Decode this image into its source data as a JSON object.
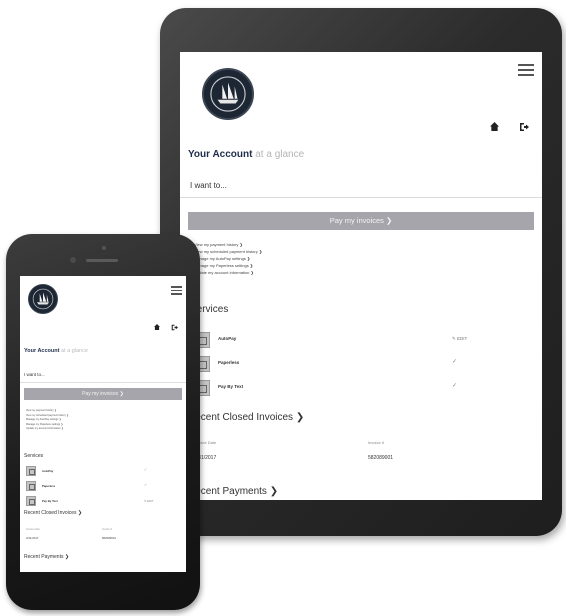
{
  "account": {
    "title": "Your Account",
    "subtitle": "at a glance",
    "i_want_to": "I want to...",
    "pay_button": "Pay my invoices  ❯",
    "links": [
      "View my payment history ❯",
      "View my scheduled payment history ❯",
      "Manage my AutoPay settings ❯",
      "Manage my Paperless settings ❯",
      "Update my account information ❯"
    ]
  },
  "services": {
    "heading": "Services",
    "items": [
      {
        "name": "AutoPay",
        "status": "✎ EDIT"
      },
      {
        "name": "Paperless",
        "status": "✓"
      },
      {
        "name": "Pay By Text",
        "status": "✓"
      }
    ]
  },
  "recent_closed_invoices": {
    "heading": "Recent Closed Invoices  ❯",
    "col_date": "Invoice Date",
    "col_number": "Invoice #",
    "row": {
      "date": "3/31/2017",
      "number": "582089001"
    }
  },
  "recent_payments": {
    "heading": "Recent Payments  ❯"
  },
  "phone": {
    "i_want_to": "I want to...",
    "services_items": [
      {
        "name": "AutoPay",
        "status": "✓"
      },
      {
        "name": "Paperless",
        "status": "✓"
      },
      {
        "name": "Pay By Text",
        "status": "✎ EDIT"
      }
    ],
    "row": {
      "date": "3/31/2017",
      "number": "582089001"
    }
  },
  "colors": {
    "brand_navy": "#1f2d4a",
    "button_gray": "#a6a5ab",
    "device_dark": "#1e1e1e"
  },
  "icons": [
    "ship-logo-icon",
    "hamburger-menu-icon",
    "home-icon",
    "logout-icon",
    "service-icon"
  ]
}
